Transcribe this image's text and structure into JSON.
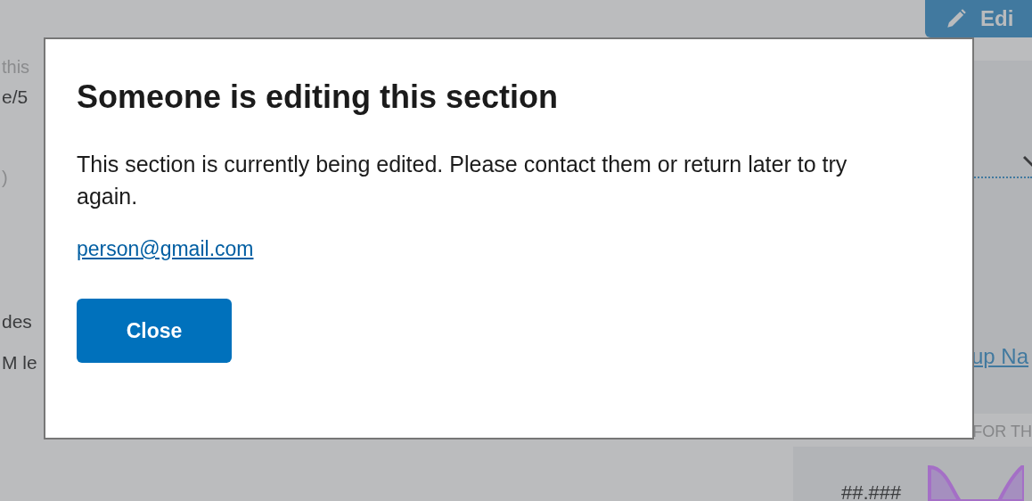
{
  "page": {
    "left_texts": [
      {
        "text": "this",
        "kind": "muted"
      },
      {
        "text": "e/5",
        "kind": "body"
      },
      {
        "text": ")",
        "kind": "muted"
      },
      {
        "text": "des",
        "kind": "body"
      },
      {
        "text": "M le",
        "kind": "body"
      }
    ],
    "edit_button": {
      "label": "Edi"
    },
    "panel_link": "up Na",
    "section_heading": "FOR TH",
    "value": "##.###"
  },
  "dialog": {
    "title": "Someone is editing this section",
    "message": "This section is currently being edited. Please contact them or return later to try again.",
    "email": "person@gmail.com",
    "close_button": "Close"
  }
}
